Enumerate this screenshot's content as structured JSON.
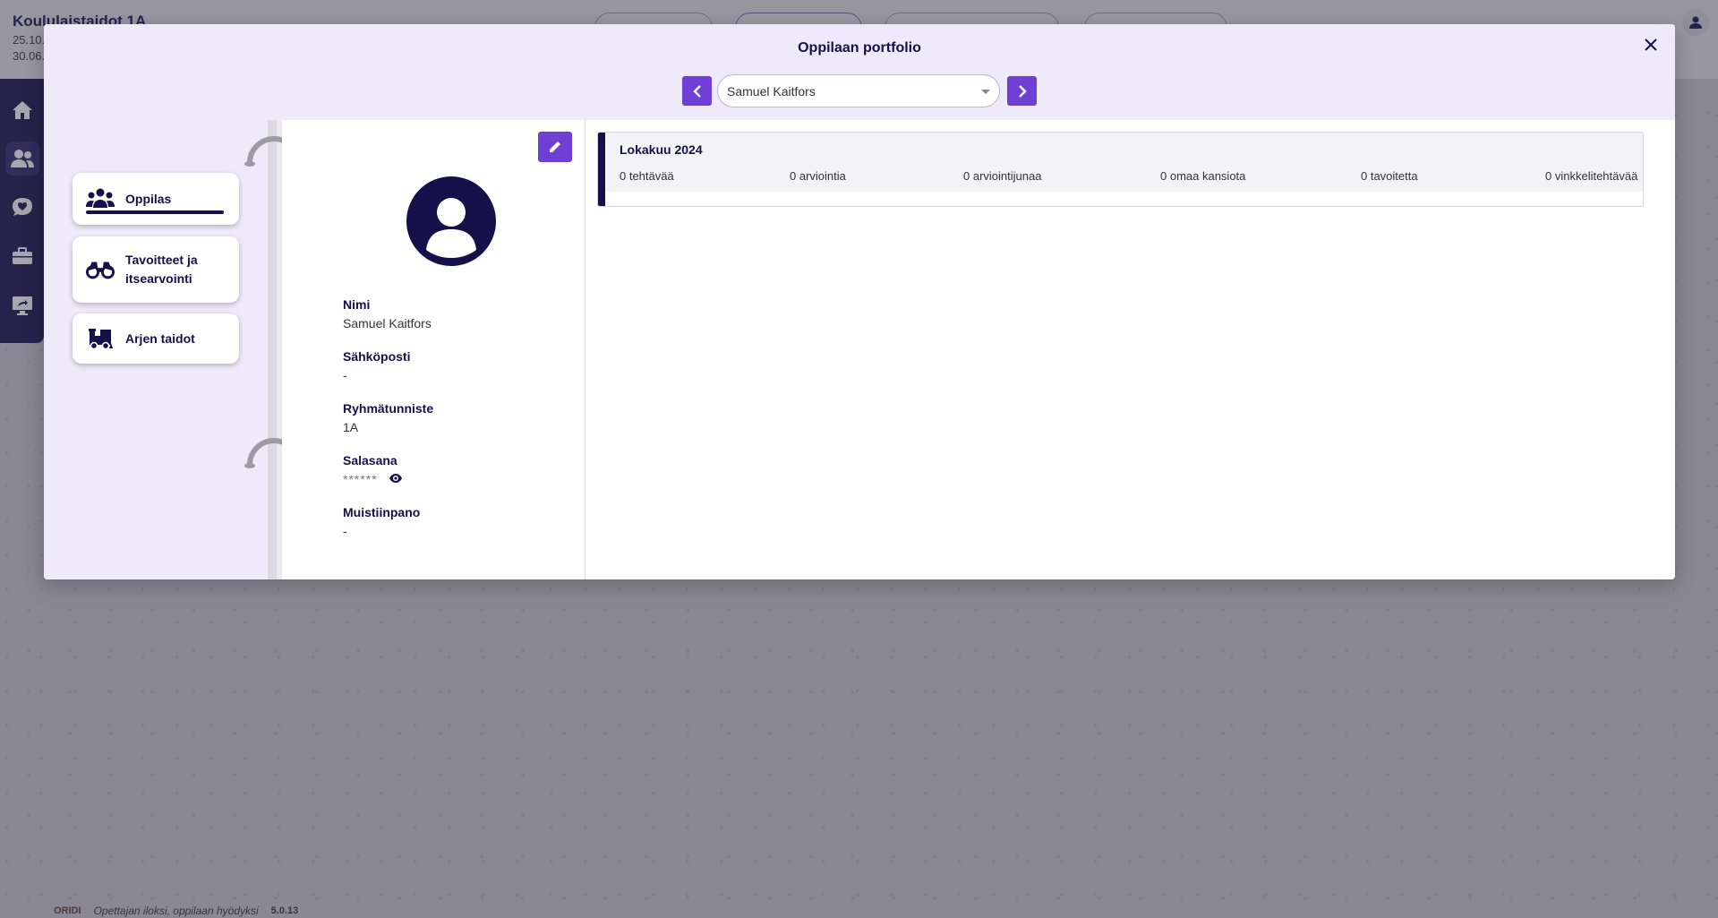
{
  "background_app": {
    "title": "Koululaistaidot 1A",
    "date_start": "25.10.",
    "date_end": "30.06.",
    "footer": {
      "logo": "ORIDI",
      "slogan": "Opettajan iloksi, oppilaan hyödyksi",
      "version": "5.0.13"
    },
    "sidebar_icons": [
      "home-icon",
      "users-icon",
      "heart-bubble-icon",
      "briefcase-icon",
      "screen-share-icon"
    ]
  },
  "modal": {
    "title": "Oppilaan portfolio",
    "student_select": {
      "value": "Samuel Kaitfors"
    },
    "nav": [
      {
        "label": "Oppilas",
        "icon": "users-icon",
        "active": true
      },
      {
        "label": "Tavoitteet ja itsearvointi",
        "icon": "binoculars-icon",
        "active": false
      },
      {
        "label": "Arjen taidot",
        "icon": "train-icon",
        "active": false
      }
    ],
    "profile": {
      "name_label": "Nimi",
      "name_value": "Samuel Kaitfors",
      "email_label": "Sähköposti",
      "email_value": "-",
      "group_label": "Ryhmätunniste",
      "group_value": "1A",
      "password_label": "Salasana",
      "password_value": "******",
      "note_label": "Muistiinpano",
      "note_value": "-"
    },
    "month_card": {
      "title": "Lokakuu 2024",
      "stats": [
        "0 tehtävää",
        "0 arviointia",
        "0 arviointijunaa",
        "0 omaa kansiota",
        "0 tavoitetta",
        "0 vinkkelitehtävää"
      ]
    }
  },
  "colors": {
    "primary_dark": "#15104a",
    "accent_purple": "#6f3fd6",
    "header_lavender": "#efeaf9"
  }
}
